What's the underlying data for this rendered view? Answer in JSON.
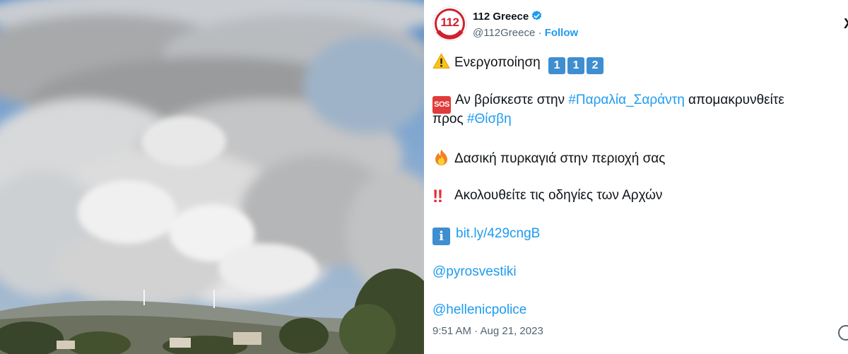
{
  "photo": {
    "alt": ""
  },
  "tweet": {
    "avatar_text": "112",
    "display_name": "112 Greece",
    "handle": "@112Greece",
    "separator": "·",
    "follow_label": "Follow",
    "x_logo": "X",
    "line1_text": "Ενεργοποίηση",
    "keycaps": [
      "1",
      "1",
      "2"
    ],
    "sos_label": "SOS",
    "line2_pre": "Αν βρίσκεστε στην ",
    "line2_tag": "#Παραλία_Σαράντη",
    "line2_post": " απομακρυνθείτε",
    "line3_pre": "προς ",
    "line3_tag": "#Θίσβη",
    "line4_text": "Δασική πυρκαγιά στην περιοχή σας",
    "bang_glyph": "‼",
    "line5_text": "Ακολουθείτε τις οδηγίες των Αρχών",
    "info_glyph": "i",
    "line6_link": "bit.ly/429cngB",
    "line7_mention": "@pyrosvestiki",
    "line8_mention": "@hellenicpolice",
    "timestamp": "9:51 AM · Aug 21, 2023"
  },
  "icons": {
    "warning": "warning-icon",
    "sos": "sos-icon",
    "fire": "fire-icon",
    "double_exclamation": "double-exclamation-icon",
    "info": "information-icon",
    "verified": "verified-badge-icon",
    "x_logo": "x-logo-icon"
  },
  "colors": {
    "link": "#1d9bf0",
    "muted": "#536471",
    "text": "#0f1419",
    "keycap": "#3e8ed0",
    "brand_red": "#d0202f"
  }
}
